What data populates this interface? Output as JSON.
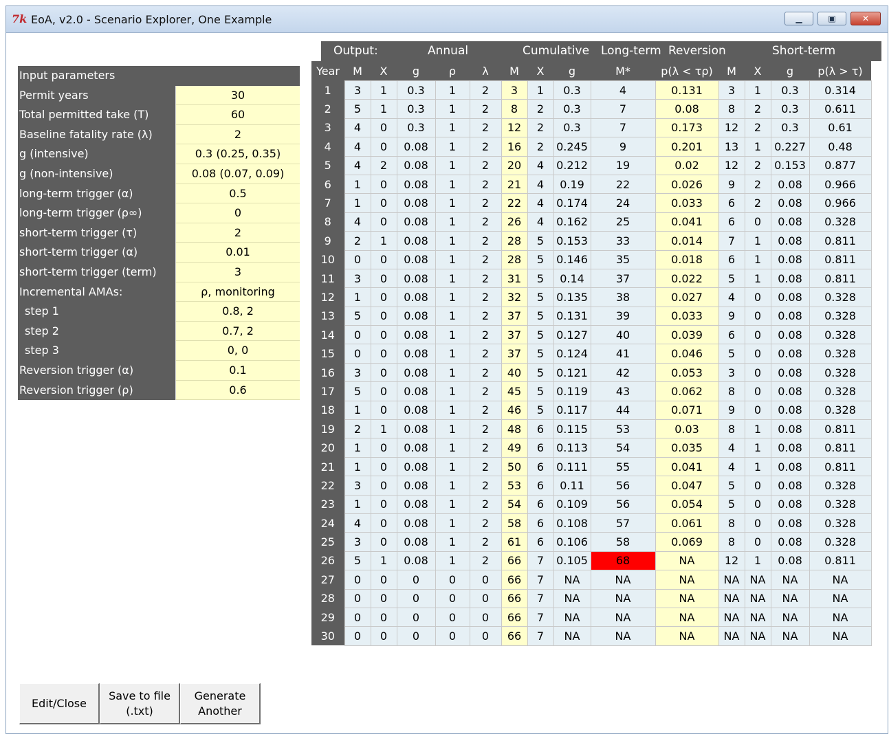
{
  "window": {
    "logo": "7k",
    "title": "EoA, v2.0 - Scenario Explorer, One Example",
    "controls": [
      "▁",
      "▣",
      "✕"
    ]
  },
  "params": {
    "header": "Input parameters",
    "rows": [
      {
        "label": "Permit years",
        "value": "30"
      },
      {
        "label": "Total permitted take (T)",
        "value": "60"
      },
      {
        "label": "Baseline fatality rate (λ)",
        "value": "2"
      },
      {
        "label": "g (intensive)",
        "value": "0.3 (0.25, 0.35)"
      },
      {
        "label": "g (non-intensive)",
        "value": "0.08 (0.07, 0.09)"
      },
      {
        "label": "long-term trigger (α)",
        "value": "0.5"
      },
      {
        "label": "long-term trigger (ρ∞)",
        "value": "0"
      },
      {
        "label": "short-term trigger (τ)",
        "value": "2"
      },
      {
        "label": "short-term trigger (α)",
        "value": "0.01"
      },
      {
        "label": "short-term trigger (term)",
        "value": "3"
      },
      {
        "label": "Incremental AMAs:",
        "value": "ρ, monitoring"
      },
      {
        "label": "step 1",
        "value": "0.8, 2"
      },
      {
        "label": "step 2",
        "value": "0.7, 2"
      },
      {
        "label": "step 3",
        "value": "0, 0"
      },
      {
        "label": "Reversion trigger (α)",
        "value": "0.1"
      },
      {
        "label": "Reversion trigger (ρ)",
        "value": "0.6"
      }
    ]
  },
  "output": {
    "groups": {
      "output": "Output:",
      "annual": "Annual",
      "cumulative": "Cumulative",
      "longterm": "Long-term",
      "reversion": "Reversion",
      "shortterm": "Short-term"
    },
    "columns": [
      "Year",
      "M",
      "X",
      "g",
      "ρ",
      "λ",
      "M",
      "X",
      "g",
      "M*",
      "p(λ < τρ)",
      "M",
      "X",
      "g",
      "p(λ > τ)"
    ],
    "rows": [
      [
        "1",
        "3",
        "1",
        "0.3",
        "1",
        "2",
        "3",
        "1",
        "0.3",
        "4",
        "0.131",
        "3",
        "1",
        "0.3",
        "0.314"
      ],
      [
        "2",
        "5",
        "1",
        "0.3",
        "1",
        "2",
        "8",
        "2",
        "0.3",
        "7",
        "0.08",
        "8",
        "2",
        "0.3",
        "0.611"
      ],
      [
        "3",
        "4",
        "0",
        "0.3",
        "1",
        "2",
        "12",
        "2",
        "0.3",
        "7",
        "0.173",
        "12",
        "2",
        "0.3",
        "0.61"
      ],
      [
        "4",
        "4",
        "0",
        "0.08",
        "1",
        "2",
        "16",
        "2",
        "0.245",
        "9",
        "0.201",
        "13",
        "1",
        "0.227",
        "0.48"
      ],
      [
        "5",
        "4",
        "2",
        "0.08",
        "1",
        "2",
        "20",
        "4",
        "0.212",
        "19",
        "0.02",
        "12",
        "2",
        "0.153",
        "0.877"
      ],
      [
        "6",
        "1",
        "0",
        "0.08",
        "1",
        "2",
        "21",
        "4",
        "0.19",
        "22",
        "0.026",
        "9",
        "2",
        "0.08",
        "0.966"
      ],
      [
        "7",
        "1",
        "0",
        "0.08",
        "1",
        "2",
        "22",
        "4",
        "0.174",
        "24",
        "0.033",
        "6",
        "2",
        "0.08",
        "0.966"
      ],
      [
        "8",
        "4",
        "0",
        "0.08",
        "1",
        "2",
        "26",
        "4",
        "0.162",
        "25",
        "0.041",
        "6",
        "0",
        "0.08",
        "0.328"
      ],
      [
        "9",
        "2",
        "1",
        "0.08",
        "1",
        "2",
        "28",
        "5",
        "0.153",
        "33",
        "0.014",
        "7",
        "1",
        "0.08",
        "0.811"
      ],
      [
        "10",
        "0",
        "0",
        "0.08",
        "1",
        "2",
        "28",
        "5",
        "0.146",
        "35",
        "0.018",
        "6",
        "1",
        "0.08",
        "0.811"
      ],
      [
        "11",
        "3",
        "0",
        "0.08",
        "1",
        "2",
        "31",
        "5",
        "0.14",
        "37",
        "0.022",
        "5",
        "1",
        "0.08",
        "0.811"
      ],
      [
        "12",
        "1",
        "0",
        "0.08",
        "1",
        "2",
        "32",
        "5",
        "0.135",
        "38",
        "0.027",
        "4",
        "0",
        "0.08",
        "0.328"
      ],
      [
        "13",
        "5",
        "0",
        "0.08",
        "1",
        "2",
        "37",
        "5",
        "0.131",
        "39",
        "0.033",
        "9",
        "0",
        "0.08",
        "0.328"
      ],
      [
        "14",
        "0",
        "0",
        "0.08",
        "1",
        "2",
        "37",
        "5",
        "0.127",
        "40",
        "0.039",
        "6",
        "0",
        "0.08",
        "0.328"
      ],
      [
        "15",
        "0",
        "0",
        "0.08",
        "1",
        "2",
        "37",
        "5",
        "0.124",
        "41",
        "0.046",
        "5",
        "0",
        "0.08",
        "0.328"
      ],
      [
        "16",
        "3",
        "0",
        "0.08",
        "1",
        "2",
        "40",
        "5",
        "0.121",
        "42",
        "0.053",
        "3",
        "0",
        "0.08",
        "0.328"
      ],
      [
        "17",
        "5",
        "0",
        "0.08",
        "1",
        "2",
        "45",
        "5",
        "0.119",
        "43",
        "0.062",
        "8",
        "0",
        "0.08",
        "0.328"
      ],
      [
        "18",
        "1",
        "0",
        "0.08",
        "1",
        "2",
        "46",
        "5",
        "0.117",
        "44",
        "0.071",
        "9",
        "0",
        "0.08",
        "0.328"
      ],
      [
        "19",
        "2",
        "1",
        "0.08",
        "1",
        "2",
        "48",
        "6",
        "0.115",
        "53",
        "0.03",
        "8",
        "1",
        "0.08",
        "0.811"
      ],
      [
        "20",
        "1",
        "0",
        "0.08",
        "1",
        "2",
        "49",
        "6",
        "0.113",
        "54",
        "0.035",
        "4",
        "1",
        "0.08",
        "0.811"
      ],
      [
        "21",
        "1",
        "0",
        "0.08",
        "1",
        "2",
        "50",
        "6",
        "0.111",
        "55",
        "0.041",
        "4",
        "1",
        "0.08",
        "0.811"
      ],
      [
        "22",
        "3",
        "0",
        "0.08",
        "1",
        "2",
        "53",
        "6",
        "0.11",
        "56",
        "0.047",
        "5",
        "0",
        "0.08",
        "0.328"
      ],
      [
        "23",
        "1",
        "0",
        "0.08",
        "1",
        "2",
        "54",
        "6",
        "0.109",
        "56",
        "0.054",
        "5",
        "0",
        "0.08",
        "0.328"
      ],
      [
        "24",
        "4",
        "0",
        "0.08",
        "1",
        "2",
        "58",
        "6",
        "0.108",
        "57",
        "0.061",
        "8",
        "0",
        "0.08",
        "0.328"
      ],
      [
        "25",
        "3",
        "0",
        "0.08",
        "1",
        "2",
        "61",
        "6",
        "0.106",
        "58",
        "0.069",
        "8",
        "0",
        "0.08",
        "0.328"
      ],
      [
        "26",
        "5",
        "1",
        "0.08",
        "1",
        "2",
        "66",
        "7",
        "0.105",
        "68",
        "NA",
        "12",
        "1",
        "0.08",
        "0.811"
      ],
      [
        "27",
        "0",
        "0",
        "0",
        "0",
        "0",
        "66",
        "7",
        "NA",
        "NA",
        "NA",
        "NA",
        "NA",
        "NA",
        "NA"
      ],
      [
        "28",
        "0",
        "0",
        "0",
        "0",
        "0",
        "66",
        "7",
        "NA",
        "NA",
        "NA",
        "NA",
        "NA",
        "NA",
        "NA"
      ],
      [
        "29",
        "0",
        "0",
        "0",
        "0",
        "0",
        "66",
        "7",
        "NA",
        "NA",
        "NA",
        "NA",
        "NA",
        "NA",
        "NA"
      ],
      [
        "30",
        "0",
        "0",
        "0",
        "0",
        "0",
        "66",
        "7",
        "NA",
        "NA",
        "NA",
        "NA",
        "NA",
        "NA",
        "NA"
      ]
    ],
    "highlights": {
      "red_text_rows_col6": [
        "25",
        "26",
        "27",
        "28",
        "29",
        "30"
      ],
      "red_bg": {
        "row": "26",
        "col": 9
      }
    },
    "colors": {
      "header_bg": "#5d5d5d",
      "cell_yellow": "#ffffcc",
      "cell_blue": "#e6f0f5",
      "alert_red": "#ff0000",
      "red_text": "#e3312b"
    }
  },
  "buttons": {
    "edit": "Edit/Close",
    "save": "Save to file (.txt)",
    "generate": "Generate Another"
  }
}
